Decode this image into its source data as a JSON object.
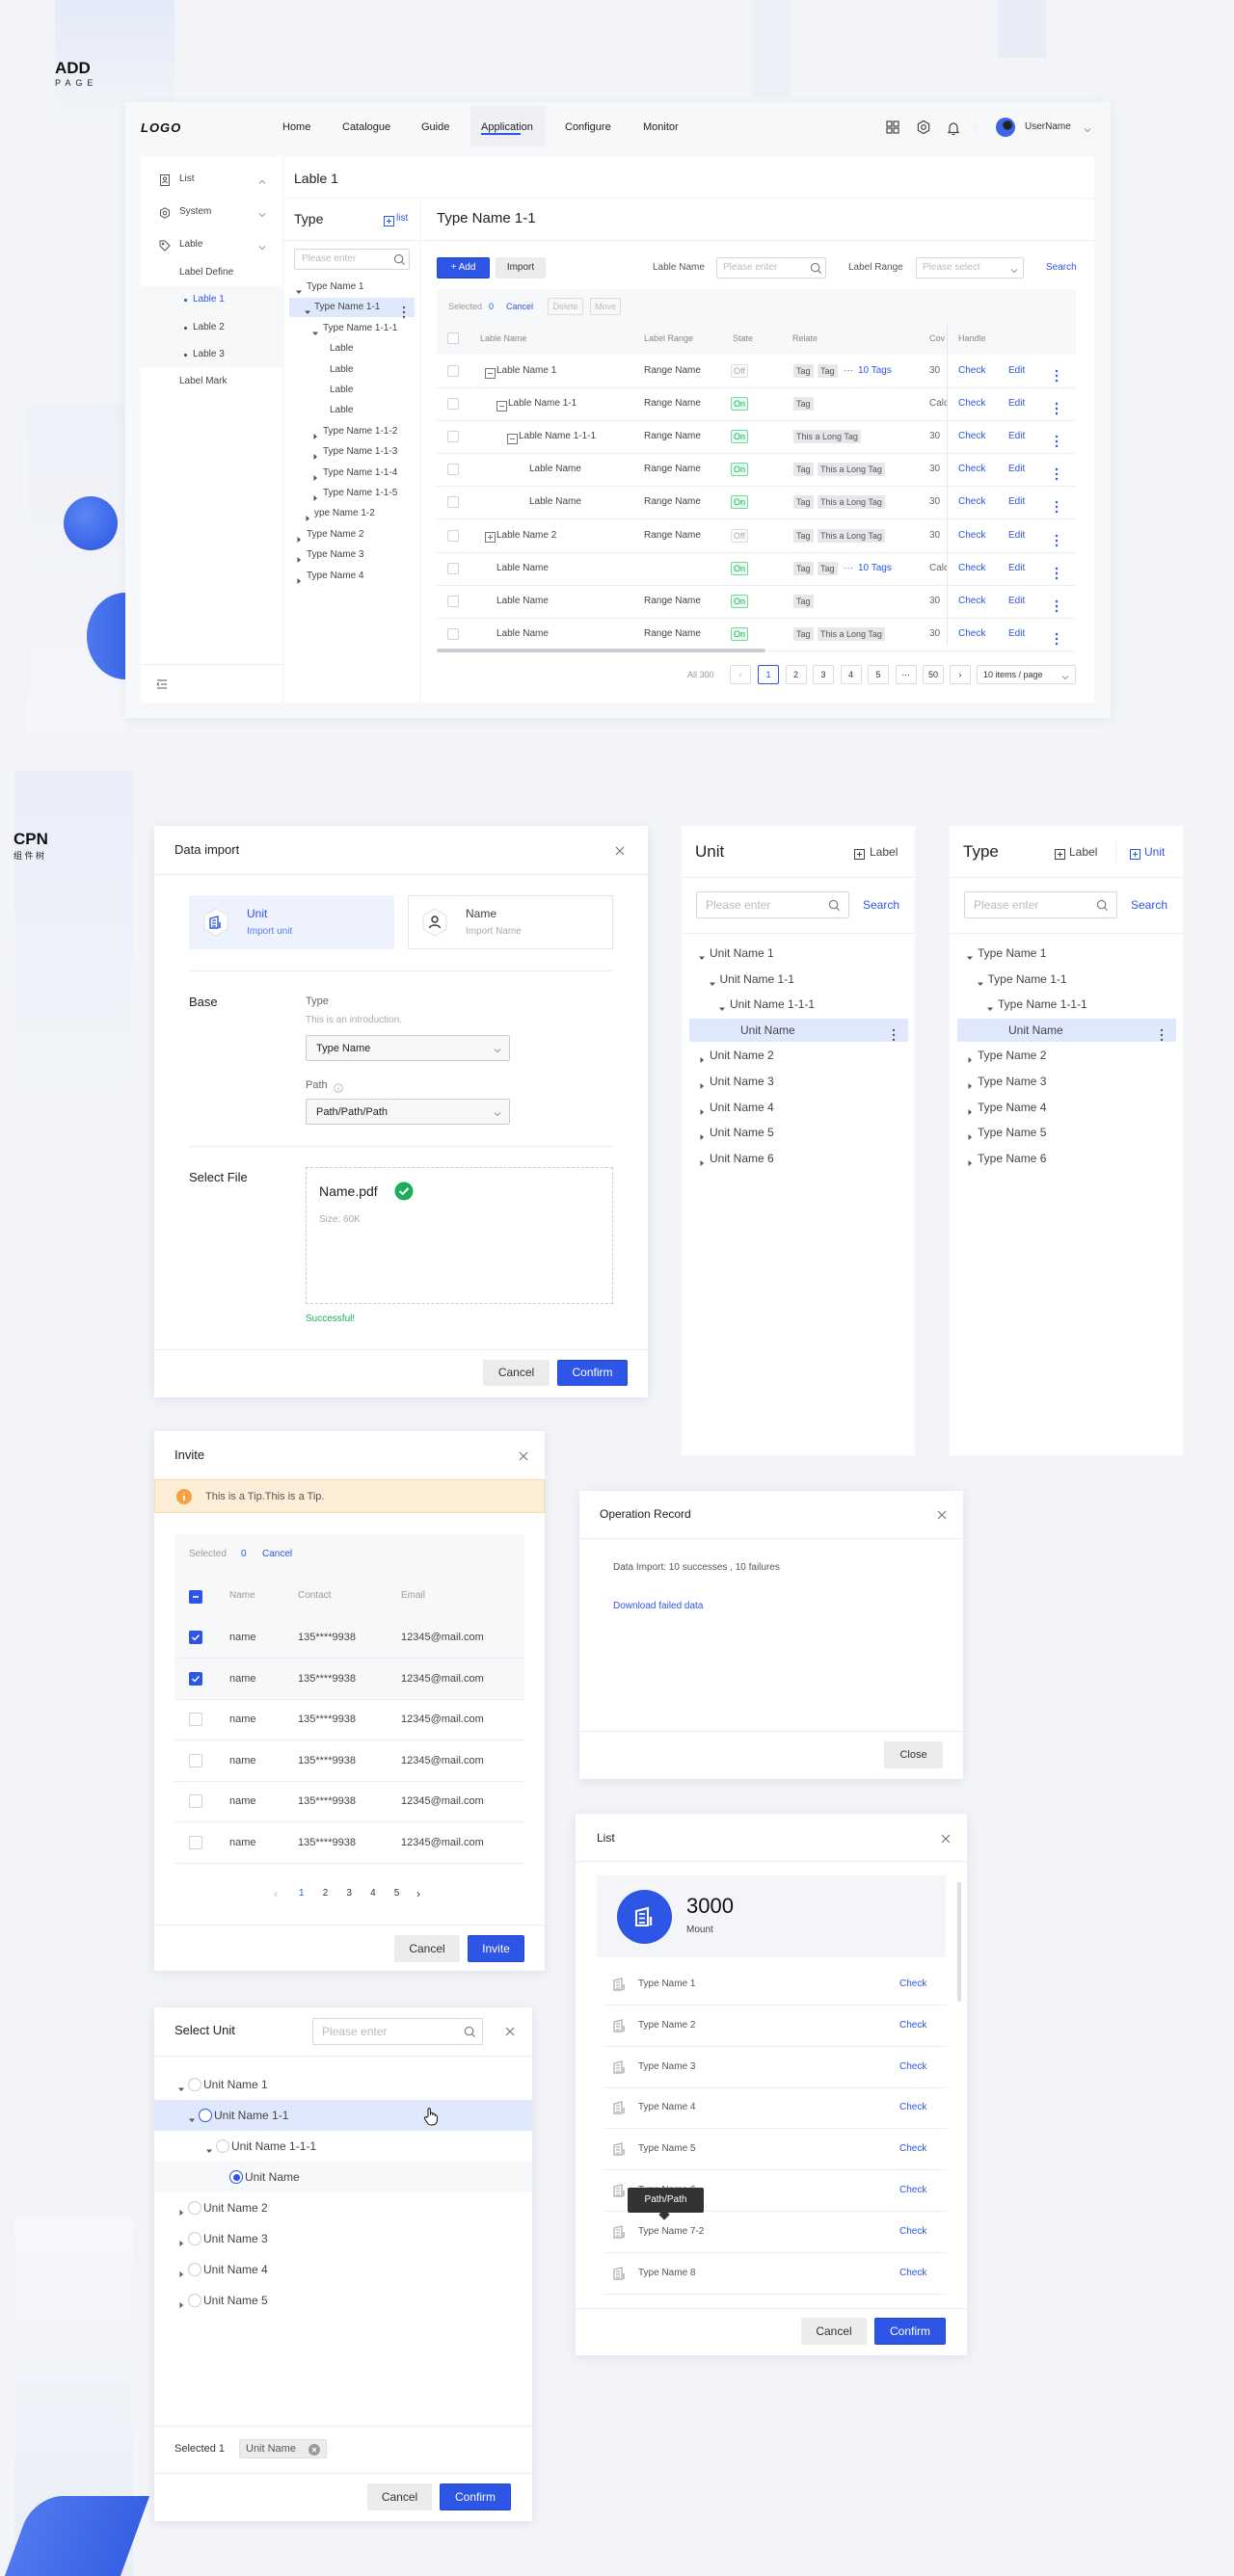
{
  "section_labels": {
    "add_title": "ADD",
    "add_sub": "PAGE",
    "cpn_title": "CPN",
    "cpn_sub": "组 件 树"
  },
  "colors": {
    "primary": "#2d55e6",
    "success": "#1aad5c",
    "warning": "#f5a243",
    "tip_bg": "#fdeed8",
    "selected_bg": "#dfe8fc"
  },
  "app": {
    "logo": "LOGO",
    "nav": [
      "Home",
      "Catalogue",
      "Guide",
      "Application",
      "Configure",
      "Monitor"
    ],
    "active_nav": 3,
    "username": "UserName",
    "sidebar": {
      "items": [
        "List",
        "System",
        "Lable"
      ],
      "label_define": "Label Define",
      "children": [
        "Lable 1",
        "Lable 2",
        "Lable 3"
      ],
      "active_child": 0,
      "label_mark": "Label Mark"
    },
    "page_title": "Lable 1",
    "type_panel": {
      "title": "Type",
      "list_btn": "list",
      "search_placeholder": "Please enter",
      "tree": [
        {
          "label": "Type Name 1",
          "level": 0,
          "arrow": "down"
        },
        {
          "label": "Type Name 1-1",
          "level": 1,
          "arrow": "down",
          "selected": true
        },
        {
          "label": "Type Name 1-1-1",
          "level": 2,
          "arrow": "down"
        },
        {
          "label": "Lable",
          "level": 3,
          "arrow": "none"
        },
        {
          "label": "Lable",
          "level": 3,
          "arrow": "none"
        },
        {
          "label": "Lable",
          "level": 3,
          "arrow": "none"
        },
        {
          "label": "Lable",
          "level": 3,
          "arrow": "none"
        },
        {
          "label": "Type Name 1-1-2",
          "level": 2,
          "arrow": "right"
        },
        {
          "label": "Type Name 1-1-3",
          "level": 2,
          "arrow": "right"
        },
        {
          "label": "Type Name 1-1-4",
          "level": 2,
          "arrow": "right"
        },
        {
          "label": "Type Name 1-1-5",
          "level": 2,
          "arrow": "right"
        },
        {
          "label": "ype Name 1-2",
          "level": 1,
          "arrow": "right"
        },
        {
          "label": "Type Name 2",
          "level": 0,
          "arrow": "right"
        },
        {
          "label": "Type Name 3",
          "level": 0,
          "arrow": "right"
        },
        {
          "label": "Type Name 4",
          "level": 0,
          "arrow": "right"
        }
      ]
    },
    "main": {
      "title": "Type Name 1-1",
      "add_btn": "+ Add",
      "import_btn": "Import",
      "filter_name_label": "Lable Name",
      "filter_name_placeholder": "Please enter",
      "filter_range_label": "Label Range",
      "filter_range_placeholder": "Please select",
      "search_btn": "Search",
      "selected_label": "Selected",
      "selected_count": "0",
      "cancel_link": "Cancel",
      "delete_btn": "Delete",
      "move_btn": "Move",
      "columns": [
        "Lable Name",
        "Label Range",
        "State",
        "Relate",
        "Cov",
        "Handle"
      ],
      "rows": [
        {
          "name": "Lable Name 1",
          "level": 0,
          "expander": "minus",
          "range": "Range Name",
          "state": "Off",
          "tags": [
            "Tag",
            "Tag"
          ],
          "more": "10 Tags",
          "cov": "30"
        },
        {
          "name": "Lable Name 1-1",
          "level": 1,
          "expander": "minus",
          "range": "Range Name",
          "state": "On",
          "tags": [
            "Tag"
          ],
          "more": null,
          "cov": "Calc"
        },
        {
          "name": "Lable Name 1-1-1",
          "level": 2,
          "expander": "minus",
          "range": "Range Name",
          "state": "On",
          "tags": [
            "This a Long Tag"
          ],
          "more": null,
          "cov": "30"
        },
        {
          "name": "Lable Name",
          "level": 3,
          "expander": null,
          "range": "Range Name",
          "state": "On",
          "tags": [
            "Tag",
            "This a Long Tag"
          ],
          "more": null,
          "cov": "30"
        },
        {
          "name": "Lable Name",
          "level": 3,
          "expander": null,
          "range": "Range Name",
          "state": "On",
          "tags": [
            "Tag",
            "This a Long Tag"
          ],
          "more": null,
          "cov": "30"
        },
        {
          "name": "Lable Name 2",
          "level": 0,
          "expander": "plus",
          "range": "Range Name",
          "state": "Off",
          "tags": [
            "Tag",
            "This a Long Tag"
          ],
          "more": null,
          "cov": "30"
        },
        {
          "name": "Lable Name",
          "level": 1,
          "expander": null,
          "range": "",
          "state": "On",
          "tags": [
            "Tag",
            "Tag"
          ],
          "more": "10 Tags",
          "cov": "Calc"
        },
        {
          "name": "Lable Name",
          "level": 1,
          "expander": null,
          "range": "Range Name",
          "state": "On",
          "tags": [
            "Tag"
          ],
          "more": null,
          "cov": "30"
        },
        {
          "name": "Lable Name",
          "level": 1,
          "expander": null,
          "range": "Range Name",
          "state": "On",
          "tags": [
            "Tag",
            "This a Long Tag"
          ],
          "more": null,
          "cov": "30"
        }
      ],
      "row_actions": {
        "check": "Check",
        "edit": "Edit"
      },
      "pagination": {
        "total": "All 300",
        "pages": [
          "1",
          "2",
          "3",
          "4",
          "5",
          "···",
          "50"
        ],
        "current": "1",
        "page_size": "10 items / page"
      }
    }
  },
  "data_import": {
    "title": "Data import",
    "cards": [
      {
        "title": "Unit",
        "subtitle": "Import unit",
        "active": true
      },
      {
        "title": "Name",
        "subtitle": "Import Name",
        "active": false
      }
    ],
    "base_label": "Base",
    "type_label": "Type",
    "type_intro": "This is an introduction.",
    "type_value": "Type Name",
    "path_label": "Path",
    "path_value": "Path/Path/Path",
    "file_label": "Select File",
    "file_name": "Name.pdf",
    "file_size": "Size:  60K",
    "status": "Successful!",
    "cancel": "Cancel",
    "confirm": "Confirm"
  },
  "unit_panel": {
    "title": "Unit",
    "label_btn": "Label",
    "search_placeholder": "Please enter",
    "search_btn": "Search",
    "tree": [
      {
        "label": "Unit Name 1",
        "level": 0,
        "arrow": "down"
      },
      {
        "label": "Unit Name 1-1",
        "level": 1,
        "arrow": "down"
      },
      {
        "label": "Unit Name 1-1-1",
        "level": 2,
        "arrow": "down"
      },
      {
        "label": "Unit Name",
        "level": 3,
        "arrow": "none",
        "selected": true
      },
      {
        "label": "Unit Name 2",
        "level": 0,
        "arrow": "right"
      },
      {
        "label": "Unit Name 3",
        "level": 0,
        "arrow": "right"
      },
      {
        "label": "Unit Name 4",
        "level": 0,
        "arrow": "right"
      },
      {
        "label": "Unit Name 5",
        "level": 0,
        "arrow": "right"
      },
      {
        "label": "Unit Name 6",
        "level": 0,
        "arrow": "right"
      }
    ]
  },
  "type_panel2": {
    "title": "Type",
    "label_btn": "Label",
    "unit_btn": "Unit",
    "search_placeholder": "Please enter",
    "search_btn": "Search",
    "tree": [
      {
        "label": "Type Name 1",
        "level": 0,
        "arrow": "down"
      },
      {
        "label": "Type Name 1-1",
        "level": 1,
        "arrow": "down"
      },
      {
        "label": "Type Name 1-1-1",
        "level": 2,
        "arrow": "down"
      },
      {
        "label": "Unit Name",
        "level": 3,
        "arrow": "none",
        "selected": true
      },
      {
        "label": "Type Name 2",
        "level": 0,
        "arrow": "right"
      },
      {
        "label": "Type Name 3",
        "level": 0,
        "arrow": "right"
      },
      {
        "label": "Type Name 4",
        "level": 0,
        "arrow": "right"
      },
      {
        "label": "Type Name 5",
        "level": 0,
        "arrow": "right"
      },
      {
        "label": "Type Name 6",
        "level": 0,
        "arrow": "right"
      }
    ]
  },
  "invite": {
    "title": "Invite",
    "tip": "This is a Tip.This is a Tip.",
    "selected_label": "Selected",
    "selected_count": "0",
    "cancel_link": "Cancel",
    "columns": [
      "Name",
      "Contact",
      "Email"
    ],
    "rows": [
      {
        "name": "name",
        "contact": "135****9938",
        "email": "12345@mail.com",
        "checked": true
      },
      {
        "name": "name",
        "contact": "135****9938",
        "email": "12345@mail.com",
        "checked": true
      },
      {
        "name": "name",
        "contact": "135****9938",
        "email": "12345@mail.com",
        "checked": false
      },
      {
        "name": "name",
        "contact": "135****9938",
        "email": "12345@mail.com",
        "checked": false
      },
      {
        "name": "name",
        "contact": "135****9938",
        "email": "12345@mail.com",
        "checked": false
      },
      {
        "name": "name",
        "contact": "135****9938",
        "email": "12345@mail.com",
        "checked": false
      }
    ],
    "pages": [
      "1",
      "2",
      "3",
      "4",
      "5"
    ],
    "current_page": "1",
    "cancel": "Cancel",
    "invite": "Invite"
  },
  "operation_record": {
    "title": "Operation Record",
    "summary": "Data Import:  10 successes , 10 failures",
    "download_link": "Download failed data",
    "close": "Close"
  },
  "list_dialog": {
    "title": "List",
    "stat_value": "3000",
    "stat_label": "Mount",
    "items": [
      "Type Name 1",
      "Type Name 2",
      "Type Name 3",
      "Type Name 4",
      "Type Name 5",
      "Type Name 6",
      "Type Name 7-2",
      "Type Name 8"
    ],
    "item_action": "Check",
    "tooltip": "Path/Path",
    "cancel": "Cancel",
    "confirm": "Confirm"
  },
  "select_unit": {
    "title": "Select Unit",
    "search_placeholder": "Please enter",
    "tree": [
      {
        "label": "Unit Name 1",
        "level": 0,
        "arrow": "down",
        "checked": false
      },
      {
        "label": "Unit Name 1-1",
        "level": 1,
        "arrow": "down",
        "checked": false,
        "hover": true
      },
      {
        "label": "Unit Name 1-1-1",
        "level": 2,
        "arrow": "down",
        "checked": false
      },
      {
        "label": "Unit Name",
        "level": 3,
        "arrow": "none",
        "checked": true
      },
      {
        "label": "Unit Name 2",
        "level": 0,
        "arrow": "right",
        "checked": false
      },
      {
        "label": "Unit Name 3",
        "level": 0,
        "arrow": "right",
        "checked": false
      },
      {
        "label": "Unit Name 4",
        "level": 0,
        "arrow": "right",
        "checked": false
      },
      {
        "label": "Unit Name 5",
        "level": 0,
        "arrow": "right",
        "checked": false
      }
    ],
    "selected_label": "Selected 1",
    "selected_chip": "Unit Name",
    "cancel": "Cancel",
    "confirm": "Confirm"
  }
}
